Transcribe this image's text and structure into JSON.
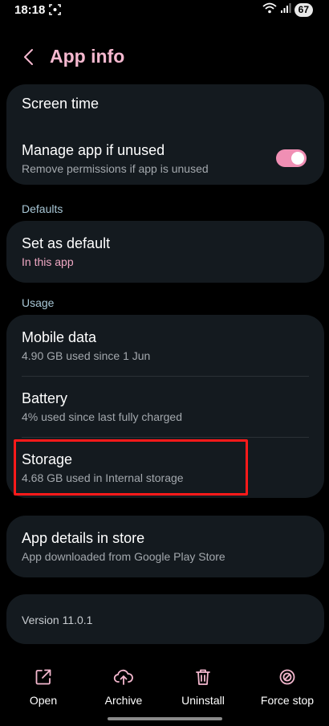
{
  "status_bar": {
    "time": "18:18",
    "battery": "67"
  },
  "header": {
    "title": "App info"
  },
  "card_top": {
    "screen_time": "Screen time",
    "manage_title": "Manage app if unused",
    "manage_sub": "Remove permissions if app is unused",
    "manage_enabled": true
  },
  "defaults": {
    "label": "Defaults",
    "set_default_title": "Set as default",
    "set_default_sub": "In this app"
  },
  "usage": {
    "label": "Usage",
    "mobile_data_title": "Mobile data",
    "mobile_data_sub": "4.90 GB used since 1 Jun",
    "battery_title": "Battery",
    "battery_sub": "4% used since last fully charged",
    "storage_title": "Storage",
    "storage_sub": "4.68 GB used in Internal storage"
  },
  "store": {
    "title": "App details in store",
    "sub": "App downloaded from Google Play Store"
  },
  "version": {
    "text": "Version 11.0.1"
  },
  "bottom_bar": {
    "open": "Open",
    "archive": "Archive",
    "uninstall": "Uninstall",
    "force_stop": "Force stop"
  },
  "colors": {
    "accent_pink": "#f5b8cf",
    "toggle_on": "#f08fb4",
    "card_bg": "#141a1f",
    "section_label": "#a8c7d6",
    "highlight": "#ff1a1a"
  }
}
